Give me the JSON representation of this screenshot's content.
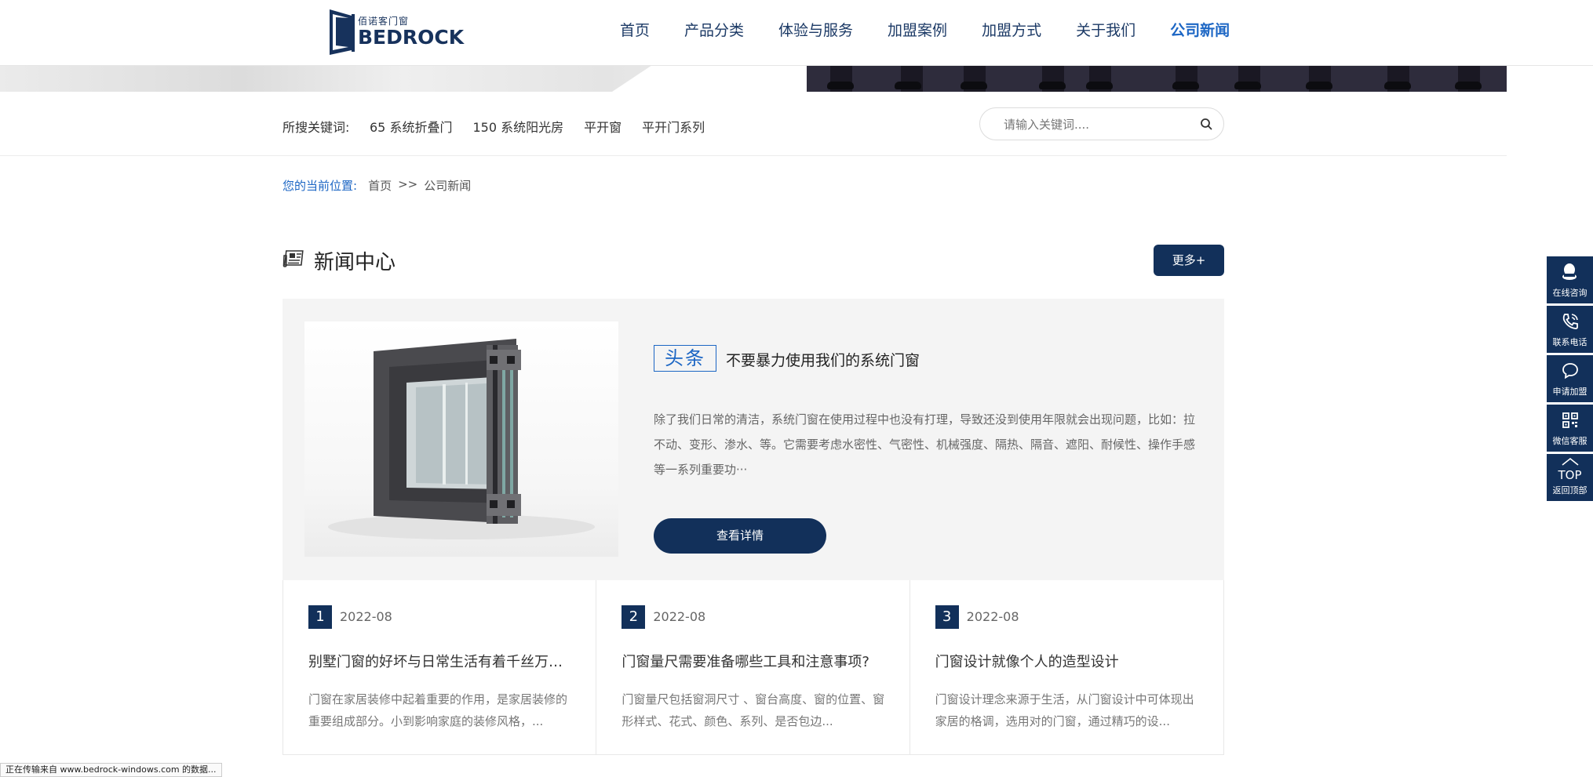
{
  "brand": {
    "name_cn": "佰诺客门窗",
    "name_en": "BEDROCK"
  },
  "nav": {
    "items": [
      {
        "label": "首页"
      },
      {
        "label": "产品分类"
      },
      {
        "label": "体验与服务"
      },
      {
        "label": "加盟案例"
      },
      {
        "label": "加盟方式"
      },
      {
        "label": "关于我们"
      },
      {
        "label": "公司新闻"
      }
    ],
    "active_index": 6
  },
  "keywords": {
    "label": "所搜关键词:",
    "items": [
      "65 系统折叠门",
      "150 系统阳光房",
      "平开窗",
      "平开门系列"
    ]
  },
  "search": {
    "placeholder": "请输入关键词...."
  },
  "breadcrumb": {
    "lead": "您的当前位置:",
    "items": [
      "首页",
      "公司新闻"
    ],
    "separator": ">>"
  },
  "section": {
    "title": "新闻中心",
    "more_label": "更多+"
  },
  "featured": {
    "tag": "头条",
    "title": "不要暴力使用我们的系统门窗",
    "description": "除了我们日常的清洁，系统门窗在使用过程中也没有打理，导致还没到使用年限就会出现问题，比如：拉不动、变形、渗水、等。它需要考虑水密性、气密性、机械强度、隔热、隔音、遮阳、耐候性、操作手感等一系列重要功···",
    "button_label": "查看详情"
  },
  "news": [
    {
      "num": "1",
      "date": "2022-08",
      "title": "别墅门窗的好坏与日常生活有着千丝万缕...",
      "desc": "门窗在家居装修中起着重要的作用，是家居装修的重要组成部分。小到影响家庭的装修风格，..."
    },
    {
      "num": "2",
      "date": "2022-08",
      "title": "门窗量尺需要准备哪些工具和注意事项?",
      "desc": "门窗量尺包括窗洞尺寸 、窗台高度、窗的位置、窗形样式、花式、颜色、系列、是否包边..."
    },
    {
      "num": "3",
      "date": "2022-08",
      "title": "门窗设计就像个人的造型设计",
      "desc": "门窗设计理念来源于生活，从门窗设计中可体现出家居的格调，选用对的门窗，通过精巧的设..."
    }
  ],
  "sidebar": [
    {
      "icon": "qq-icon",
      "label": "在线咨询"
    },
    {
      "icon": "phone-icon",
      "label": "联系电话"
    },
    {
      "icon": "chat-icon",
      "label": "申请加盟"
    },
    {
      "icon": "qrcode-icon",
      "label": "微信客服"
    },
    {
      "icon": "top-arrow-icon",
      "top_text": "TOP",
      "label": "返回顶部"
    }
  ],
  "status_bar": "正在传输来自 www.bedrock-windows.com 的数据...",
  "colors": {
    "primary": "#12305a",
    "accent": "#1c66c4",
    "featured_bg": "#f4f4f4"
  }
}
